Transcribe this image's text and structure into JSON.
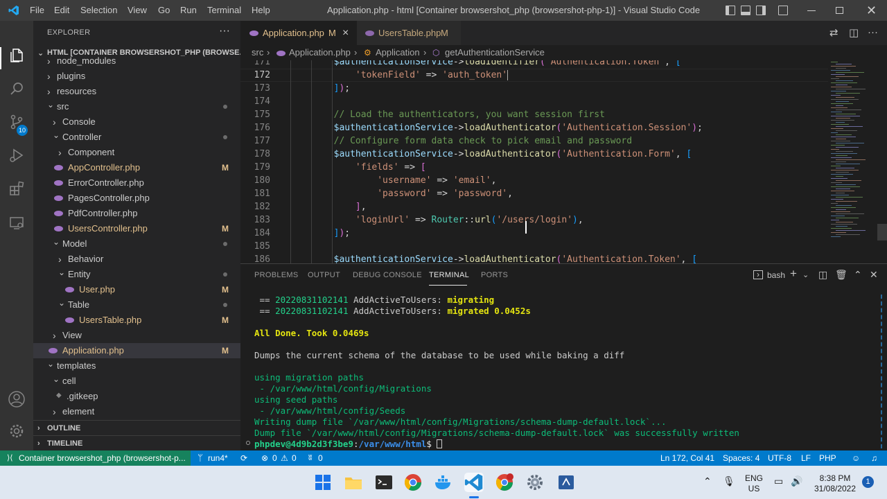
{
  "titlebar": {
    "menu": [
      "File",
      "Edit",
      "Selection",
      "View",
      "Go",
      "Run",
      "Terminal",
      "Help"
    ],
    "title": "Application.php - html [Container browsershot_php (browsershot-php-1)] - Visual Studio Code"
  },
  "activity": {
    "source_control_badge": "10"
  },
  "sidebar": {
    "header": "EXPLORER",
    "more": "···",
    "root": "HTML [CONTAINER BROWSERSHOT_PHP (BROWSE...",
    "tree": [
      {
        "label": "node_modules",
        "status": ""
      },
      {
        "label": "plugins",
        "status": ""
      },
      {
        "label": "resources",
        "status": ""
      },
      {
        "label": "src",
        "status": "dot"
      },
      {
        "label": "Console",
        "status": ""
      },
      {
        "label": "Controller",
        "status": "dot"
      },
      {
        "label": "Component",
        "status": ""
      },
      {
        "label": "AppController.php",
        "status": "M"
      },
      {
        "label": "ErrorController.php",
        "status": ""
      },
      {
        "label": "PagesController.php",
        "status": ""
      },
      {
        "label": "PdfController.php",
        "status": ""
      },
      {
        "label": "UsersController.php",
        "status": "M"
      },
      {
        "label": "Model",
        "status": "dot"
      },
      {
        "label": "Behavior",
        "status": ""
      },
      {
        "label": "Entity",
        "status": "dot"
      },
      {
        "label": "User.php",
        "status": "M"
      },
      {
        "label": "Table",
        "status": "dot"
      },
      {
        "label": "UsersTable.php",
        "status": "M"
      },
      {
        "label": "View",
        "status": ""
      },
      {
        "label": "Application.php",
        "status": "M"
      },
      {
        "label": "templates",
        "status": ""
      },
      {
        "label": "cell",
        "status": ""
      },
      {
        "label": ".gitkeep",
        "status": ""
      },
      {
        "label": "element",
        "status": ""
      }
    ],
    "outline": "OUTLINE",
    "timeline": "TIMELINE"
  },
  "tabs": [
    {
      "label": "Application.php",
      "status": "M",
      "close": "×"
    },
    {
      "label": "UsersTable.php",
      "status": "M"
    }
  ],
  "breadcrumb": [
    "src",
    "Application.php",
    "Application",
    "getAuthenticationService"
  ],
  "editor": {
    "line_numbers": [
      "171",
      "172",
      "173",
      "174",
      "175",
      "176",
      "177",
      "178",
      "179",
      "180",
      "181",
      "182",
      "183",
      "184",
      "185",
      "186"
    ]
  },
  "panel": {
    "tabs": [
      "PROBLEMS",
      "OUTPUT",
      "DEBUG CONSOLE",
      "TERMINAL",
      "PORTS"
    ],
    "active_tab": "TERMINAL",
    "shell": "bash",
    "terminal": {
      "l1a": " == ",
      "l1b": "20220831102141",
      "l1c": " AddActiveToUsers:",
      "l1d": " migrating",
      "l2a": " == ",
      "l2b": "20220831102141",
      "l2c": " AddActiveToUsers:",
      "l2d": " migrated 0.0452s",
      "l3": "All Done. Took 0.0469s",
      "l4": "Dumps the current schema of the database to be used while baking a diff",
      "l5": "using migration paths",
      "l6": " - /var/www/html/config/Migrations",
      "l7": "using seed paths",
      "l8": " - /var/www/html/config/Seeds",
      "l9": "Writing dump file `/var/www/html/config/Migrations/schema-dump-default.lock`...",
      "l10": "Dump file `/var/www/html/config/Migrations/schema-dump-default.lock` was successfully written",
      "prompt_user": "phpdev@4d9b2d3f3be9",
      "prompt_sep": ":",
      "prompt_path": "/var/www/html",
      "prompt_end": "$ "
    }
  },
  "statusbar": {
    "remote": "Container browsershot_php (browsershot-p...",
    "branch": "run4*",
    "errors": "0",
    "warnings": "0",
    "ports": "0",
    "cursor": "Ln 172, Col 41",
    "spaces": "Spaces: 4",
    "encoding": "UTF-8",
    "eol": "LF",
    "language": "PHP"
  },
  "taskbar": {
    "lang_top": "ENG",
    "lang_bottom": "US",
    "time": "8:38 PM",
    "date": "31/08/2022",
    "notifications": "1"
  },
  "colors": {
    "accent": "#007acc",
    "remote": "#16825d",
    "modified": "#e2c08d"
  }
}
